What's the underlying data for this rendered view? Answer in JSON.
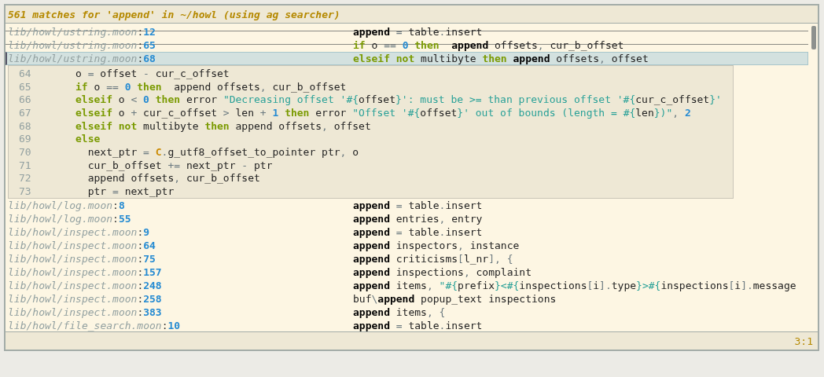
{
  "header": {
    "title": "561 matches for 'append' in ~/howl (using ag searcher)"
  },
  "results_top": [
    {
      "path": "lib/howl/ustring.moon",
      "separator": ":",
      "line": "12",
      "selected": false,
      "struck": true,
      "code": [
        {
          "kind": "match",
          "text": "append"
        },
        {
          "kind": "operator",
          "text": " = "
        },
        {
          "kind": "plain",
          "text": "table"
        },
        {
          "kind": "operator",
          "text": "."
        },
        {
          "kind": "plain",
          "text": "insert"
        }
      ]
    },
    {
      "path": "lib/howl/ustring.moon",
      "separator": ":",
      "line": "65",
      "selected": false,
      "struck": true,
      "code": [
        {
          "kind": "keyword",
          "text": "if"
        },
        {
          "kind": "plain",
          "text": " o "
        },
        {
          "kind": "operator",
          "text": "== "
        },
        {
          "kind": "number",
          "text": "0"
        },
        {
          "kind": "keyword",
          "text": " then"
        },
        {
          "kind": "match",
          "text": "  append"
        },
        {
          "kind": "plain",
          "text": " offsets"
        },
        {
          "kind": "operator",
          "text": ", "
        },
        {
          "kind": "plain",
          "text": "cur_b_offset"
        }
      ]
    },
    {
      "path": "lib/howl/ustring.moon",
      "separator": ":",
      "line": "68",
      "selected": true,
      "struck": false,
      "code": [
        {
          "kind": "keyword",
          "text": "elseif not"
        },
        {
          "kind": "plain",
          "text": " multibyte "
        },
        {
          "kind": "keyword",
          "text": "then"
        },
        {
          "kind": "match",
          "text": " append"
        },
        {
          "kind": "plain",
          "text": " offsets"
        },
        {
          "kind": "operator",
          "text": ", "
        },
        {
          "kind": "plain",
          "text": "offset"
        }
      ]
    }
  ],
  "preview": {
    "lines": [
      {
        "number": "64",
        "code": [
          {
            "kind": "plain",
            "text": "o "
          },
          {
            "kind": "operator",
            "text": "= "
          },
          {
            "kind": "plain",
            "text": "offset "
          },
          {
            "kind": "operator",
            "text": "- "
          },
          {
            "kind": "plain",
            "text": "cur_c_offset"
          }
        ]
      },
      {
        "number": "65",
        "code": [
          {
            "kind": "keyword",
            "text": "if"
          },
          {
            "kind": "plain",
            "text": " o "
          },
          {
            "kind": "operator",
            "text": "== "
          },
          {
            "kind": "number",
            "text": "0"
          },
          {
            "kind": "keyword",
            "text": " then"
          },
          {
            "kind": "plain",
            "text": "  append offsets"
          },
          {
            "kind": "operator",
            "text": ", "
          },
          {
            "kind": "plain",
            "text": "cur_b_offset"
          }
        ]
      },
      {
        "number": "66",
        "code": [
          {
            "kind": "keyword",
            "text": "elseif"
          },
          {
            "kind": "plain",
            "text": " o "
          },
          {
            "kind": "operator",
            "text": "< "
          },
          {
            "kind": "number",
            "text": "0"
          },
          {
            "kind": "keyword",
            "text": " then"
          },
          {
            "kind": "plain",
            "text": " error "
          },
          {
            "kind": "string",
            "text": "\"Decreasing offset '#{"
          },
          {
            "kind": "plain",
            "text": "offset"
          },
          {
            "kind": "string",
            "text": "}': must be >= than previous offset '#{"
          },
          {
            "kind": "plain",
            "text": "cur_c_offset"
          },
          {
            "kind": "string",
            "text": "}'"
          }
        ]
      },
      {
        "number": "67",
        "code": [
          {
            "kind": "keyword",
            "text": "elseif"
          },
          {
            "kind": "plain",
            "text": " o "
          },
          {
            "kind": "operator",
            "text": "+ "
          },
          {
            "kind": "plain",
            "text": "cur_c_offset "
          },
          {
            "kind": "operator",
            "text": "> "
          },
          {
            "kind": "plain",
            "text": "len "
          },
          {
            "kind": "operator",
            "text": "+ "
          },
          {
            "kind": "number",
            "text": "1"
          },
          {
            "kind": "keyword",
            "text": " then"
          },
          {
            "kind": "plain",
            "text": " error "
          },
          {
            "kind": "string",
            "text": "\"Offset '#{"
          },
          {
            "kind": "plain",
            "text": "offset"
          },
          {
            "kind": "string",
            "text": "}' out of bounds (length = #{"
          },
          {
            "kind": "plain",
            "text": "len"
          },
          {
            "kind": "string",
            "text": "})\""
          },
          {
            "kind": "operator",
            "text": ", "
          },
          {
            "kind": "number",
            "text": "2"
          }
        ]
      },
      {
        "number": "68",
        "code": [
          {
            "kind": "keyword",
            "text": "elseif not"
          },
          {
            "kind": "plain",
            "text": " multibyte "
          },
          {
            "kind": "keyword",
            "text": "then"
          },
          {
            "kind": "plain",
            "text": " append offsets"
          },
          {
            "kind": "operator",
            "text": ", "
          },
          {
            "kind": "plain",
            "text": "offset"
          }
        ]
      },
      {
        "number": "69",
        "code": [
          {
            "kind": "keyword",
            "text": "else"
          }
        ]
      },
      {
        "number": "70",
        "code": [
          {
            "kind": "plain",
            "text": "  next_ptr "
          },
          {
            "kind": "operator",
            "text": "= "
          },
          {
            "kind": "constant",
            "text": "C"
          },
          {
            "kind": "operator",
            "text": "."
          },
          {
            "kind": "plain",
            "text": "g_utf8_offset_to_pointer ptr"
          },
          {
            "kind": "operator",
            "text": ", "
          },
          {
            "kind": "plain",
            "text": "o"
          }
        ]
      },
      {
        "number": "71",
        "code": [
          {
            "kind": "plain",
            "text": "  cur_b_offset "
          },
          {
            "kind": "operator",
            "text": "+= "
          },
          {
            "kind": "plain",
            "text": "next_ptr "
          },
          {
            "kind": "operator",
            "text": "- "
          },
          {
            "kind": "plain",
            "text": "ptr"
          }
        ]
      },
      {
        "number": "72",
        "code": [
          {
            "kind": "plain",
            "text": "  append offsets"
          },
          {
            "kind": "operator",
            "text": ", "
          },
          {
            "kind": "plain",
            "text": "cur_b_offset"
          }
        ]
      },
      {
        "number": "73",
        "code": [
          {
            "kind": "plain",
            "text": "  ptr "
          },
          {
            "kind": "operator",
            "text": "= "
          },
          {
            "kind": "plain",
            "text": "next_ptr"
          }
        ]
      }
    ]
  },
  "results_bottom": [
    {
      "path": "lib/howl/log.moon",
      "separator": ":",
      "line": "8",
      "selected": false,
      "struck": false,
      "code": [
        {
          "kind": "match",
          "text": "append"
        },
        {
          "kind": "operator",
          "text": " = "
        },
        {
          "kind": "plain",
          "text": "table"
        },
        {
          "kind": "operator",
          "text": "."
        },
        {
          "kind": "plain",
          "text": "insert"
        }
      ]
    },
    {
      "path": "lib/howl/log.moon",
      "separator": ":",
      "line": "55",
      "selected": false,
      "struck": false,
      "code": [
        {
          "kind": "match",
          "text": "append"
        },
        {
          "kind": "plain",
          "text": " entries"
        },
        {
          "kind": "operator",
          "text": ", "
        },
        {
          "kind": "plain",
          "text": "entry"
        }
      ]
    },
    {
      "path": "lib/howl/inspect.moon",
      "separator": ":",
      "line": "9",
      "selected": false,
      "struck": false,
      "code": [
        {
          "kind": "match",
          "text": "append"
        },
        {
          "kind": "operator",
          "text": " = "
        },
        {
          "kind": "plain",
          "text": "table"
        },
        {
          "kind": "operator",
          "text": "."
        },
        {
          "kind": "plain",
          "text": "insert"
        }
      ]
    },
    {
      "path": "lib/howl/inspect.moon",
      "separator": ":",
      "line": "64",
      "selected": false,
      "struck": false,
      "code": [
        {
          "kind": "match",
          "text": "append"
        },
        {
          "kind": "plain",
          "text": " inspectors"
        },
        {
          "kind": "operator",
          "text": ", "
        },
        {
          "kind": "plain",
          "text": "instance"
        }
      ]
    },
    {
      "path": "lib/howl/inspect.moon",
      "separator": ":",
      "line": "75",
      "selected": false,
      "struck": false,
      "code": [
        {
          "kind": "match",
          "text": "append"
        },
        {
          "kind": "plain",
          "text": " criticisms"
        },
        {
          "kind": "operator",
          "text": "["
        },
        {
          "kind": "plain",
          "text": "l_nr"
        },
        {
          "kind": "operator",
          "text": "], {"
        }
      ]
    },
    {
      "path": "lib/howl/inspect.moon",
      "separator": ":",
      "line": "157",
      "selected": false,
      "struck": false,
      "code": [
        {
          "kind": "match",
          "text": "append"
        },
        {
          "kind": "plain",
          "text": " inspections"
        },
        {
          "kind": "operator",
          "text": ", "
        },
        {
          "kind": "plain",
          "text": "complaint"
        }
      ]
    },
    {
      "path": "lib/howl/inspect.moon",
      "separator": ":",
      "line": "248",
      "selected": false,
      "struck": false,
      "code": [
        {
          "kind": "match",
          "text": "append"
        },
        {
          "kind": "plain",
          "text": " items"
        },
        {
          "kind": "operator",
          "text": ", "
        },
        {
          "kind": "string",
          "text": "\"#{"
        },
        {
          "kind": "plain",
          "text": "prefix"
        },
        {
          "kind": "string",
          "text": "}<#{"
        },
        {
          "kind": "plain",
          "text": "inspections"
        },
        {
          "kind": "operator",
          "text": "["
        },
        {
          "kind": "plain",
          "text": "i"
        },
        {
          "kind": "operator",
          "text": "]."
        },
        {
          "kind": "plain",
          "text": "type"
        },
        {
          "kind": "string",
          "text": "}>#{"
        },
        {
          "kind": "plain",
          "text": "inspections"
        },
        {
          "kind": "operator",
          "text": "["
        },
        {
          "kind": "plain",
          "text": "i"
        },
        {
          "kind": "operator",
          "text": "]."
        },
        {
          "kind": "plain",
          "text": "message"
        }
      ]
    },
    {
      "path": "lib/howl/inspect.moon",
      "separator": ":",
      "line": "258",
      "selected": false,
      "struck": false,
      "code": [
        {
          "kind": "plain",
          "text": "buf"
        },
        {
          "kind": "operator",
          "text": "\\"
        },
        {
          "kind": "match",
          "text": "append"
        },
        {
          "kind": "plain",
          "text": " popup_text inspections"
        }
      ]
    },
    {
      "path": "lib/howl/inspect.moon",
      "separator": ":",
      "line": "383",
      "selected": false,
      "struck": false,
      "code": [
        {
          "kind": "match",
          "text": "append"
        },
        {
          "kind": "plain",
          "text": " items"
        },
        {
          "kind": "operator",
          "text": ", {"
        }
      ]
    },
    {
      "path": "lib/howl/file_search.moon",
      "separator": ":",
      "line": "10",
      "selected": false,
      "struck": false,
      "code": [
        {
          "kind": "match",
          "text": "append"
        },
        {
          "kind": "operator",
          "text": " = "
        },
        {
          "kind": "plain",
          "text": "table"
        },
        {
          "kind": "operator",
          "text": "."
        },
        {
          "kind": "plain",
          "text": "insert"
        }
      ]
    }
  ],
  "status_bar": {
    "position": "3:1"
  }
}
